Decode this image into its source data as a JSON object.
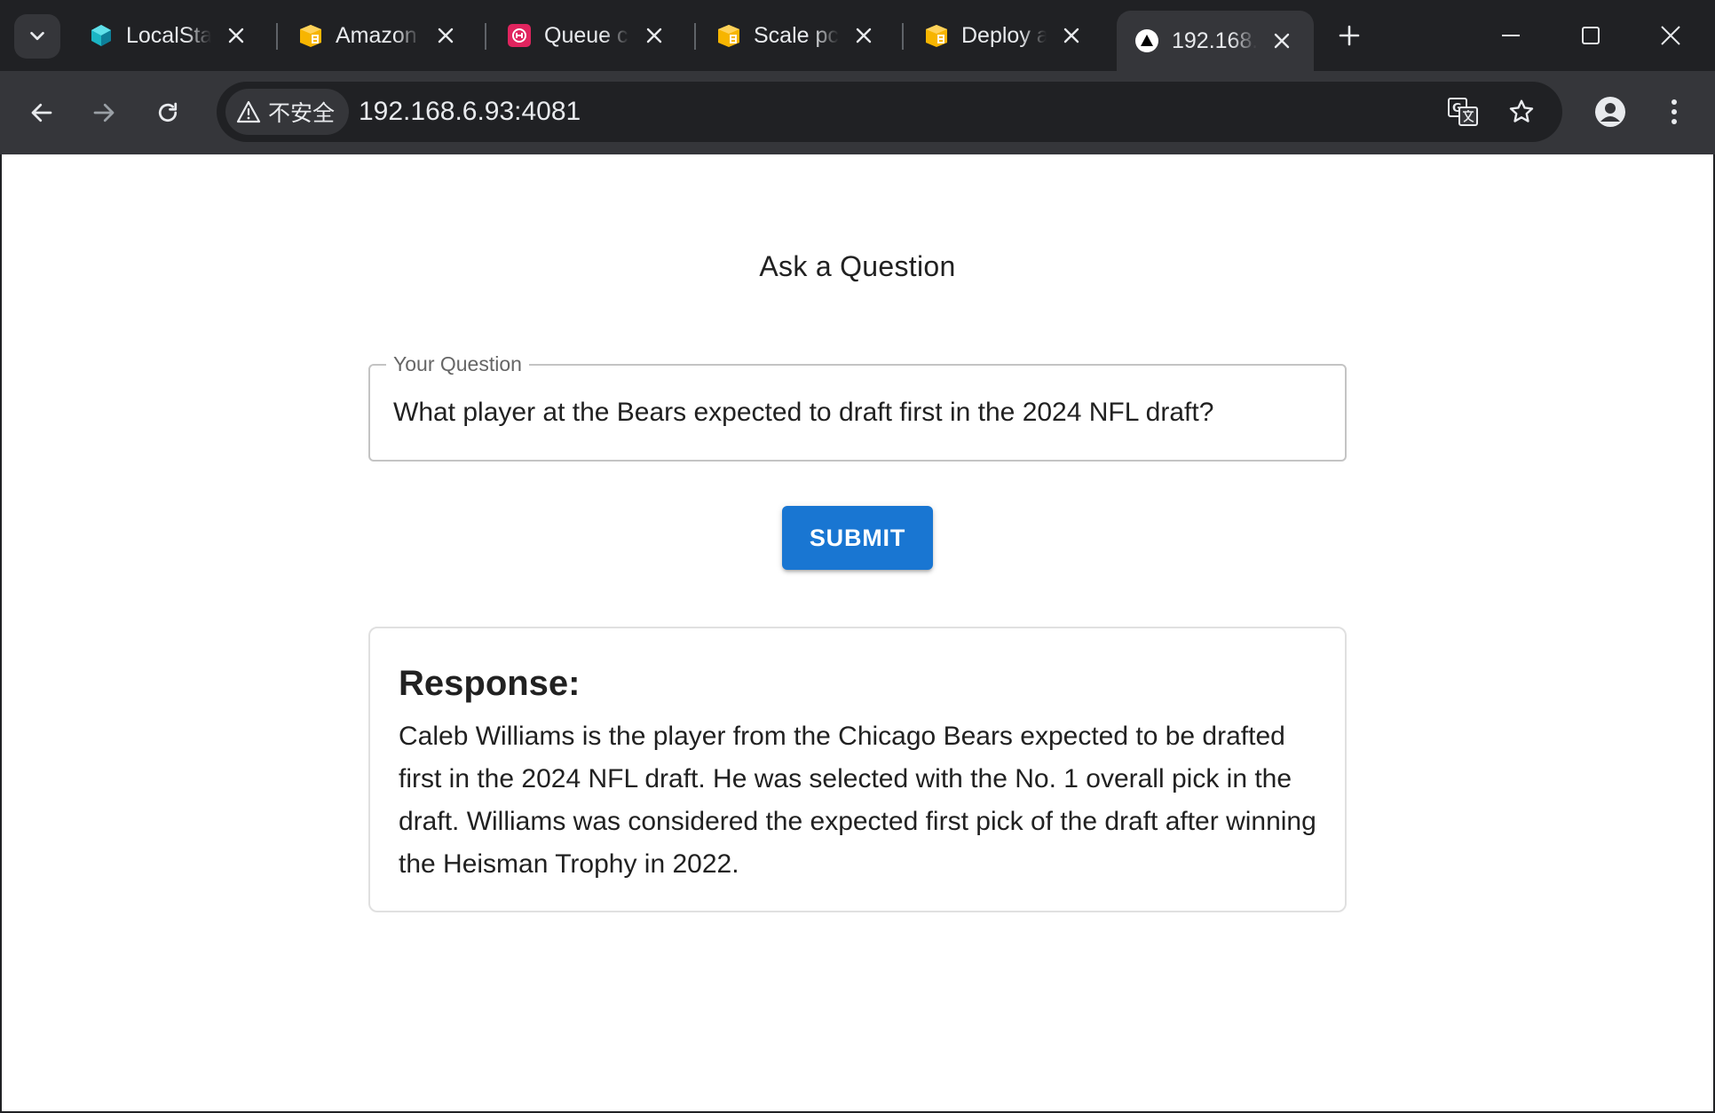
{
  "browser": {
    "tabs": [
      {
        "title": "LocalSta",
        "favicon": "cube-icon",
        "active": false
      },
      {
        "title": "Amazon",
        "favicon": "aws-package-icon",
        "active": false
      },
      {
        "title": "Queue c",
        "favicon": "queue-icon",
        "active": false
      },
      {
        "title": "Scale pc",
        "favicon": "aws-package-icon",
        "active": false
      },
      {
        "title": "Deploy a",
        "favicon": "aws-package-icon",
        "active": false
      },
      {
        "title": "192.168.",
        "favicon": "triangle-icon",
        "active": true
      }
    ],
    "security_chip": "不安全",
    "url": "192.168.6.93:4081"
  },
  "page": {
    "title": "Ask a Question",
    "question_field": {
      "label": "Your Question",
      "value": "What player at the Bears expected to draft first in the 2024 NFL draft?"
    },
    "submit_label": "SUBMIT",
    "response": {
      "heading": "Response:",
      "text": "Caleb Williams is the player from the Chicago Bears expected to be drafted first in the 2024 NFL draft. He was selected with the No. 1 overall pick in the draft. Williams was considered the expected first pick of the draft after winning the Heisman Trophy in 2022."
    }
  },
  "colors": {
    "chrome_dark": "#202124",
    "chrome_toolbar": "#35363a",
    "primary_button": "#1976d2"
  }
}
